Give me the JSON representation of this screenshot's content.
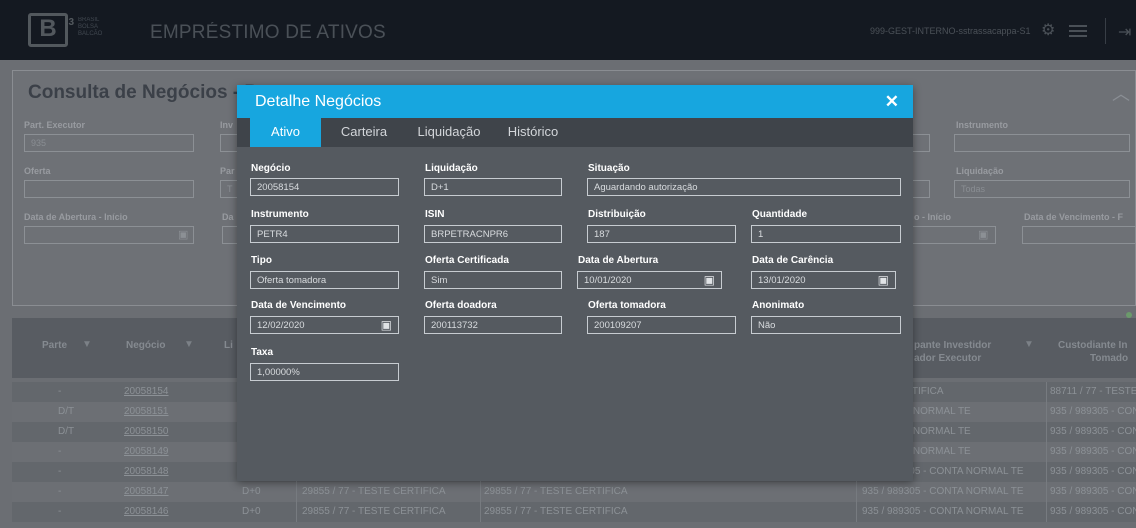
{
  "header": {
    "logo_text": "B",
    "logo_sup": "3",
    "logo_sub": [
      "BRASIL",
      "BOLSA",
      "BALCÃO"
    ],
    "app_title": "EMPRÉSTIMO DE ATIVOS",
    "user": "999-GEST-INTERNO-sstrassacappa-S1",
    "icons": [
      "gear-icon",
      "menu-icon",
      "logout-icon"
    ]
  },
  "background": {
    "title": "Consulta de Negócios - P",
    "filters": {
      "part_executor_label": "Part. Executor",
      "part_executor_value": "935",
      "inv_label": "Inv",
      "instrumento_label": "Instrumento",
      "oferta_label": "Oferta",
      "par_label": "Par",
      "liquidacao_label": "Liquidação",
      "liquidacao_value": "Todas",
      "abertura_label": "Data de Abertura - Início",
      "da_label": "Da",
      "o_inicio_label": "o - Início",
      "vencimento_label": "Data de Vencimento - F",
      "t_value": "T"
    },
    "table": {
      "headers": {
        "parte": "Parte",
        "negocio": "Negócio",
        "li": "Li",
        "part_inv_1": "pante Investidor",
        "part_inv_2": "ador Executor",
        "custodiante_1": "Custodiante In",
        "custodiante_2": "Tomado"
      },
      "rows": [
        {
          "parte": "-",
          "negocio": "20058154",
          "c1": "",
          "c2": "",
          "c3": "",
          "part": "ESTE CERTIFICA",
          "cust": "88711 / 77 - TESTE C"
        },
        {
          "parte": "D/T",
          "negocio": "20058151",
          "c1": "",
          "c2": "",
          "c3": "",
          "part": "5 - CONTA NORMAL TE",
          "cust": "935 / 989305 - CON"
        },
        {
          "parte": "D/T",
          "negocio": "20058150",
          "c1": "",
          "c2": "",
          "c3": "",
          "part": "5 - CONTA NORMAL TE",
          "cust": "935 / 989305 - CON"
        },
        {
          "parte": "-",
          "negocio": "20058149",
          "c1": "",
          "c2": "",
          "c3": "",
          "part": "5 - CONTA NORMAL TE",
          "cust": "935 / 989305 - CON"
        },
        {
          "parte": "-",
          "negocio": "20058148",
          "c1": "D+0",
          "c2": "29855 / 77 - TESTE CERTIFICA",
          "c3": "29855 / 77 - TESTE CERTIFICA",
          "part": "935 / 989305 - CONTA NORMAL TE",
          "cust": "935 / 989305 - CON"
        },
        {
          "parte": "-",
          "negocio": "20058147",
          "c1": "D+0",
          "c2": "29855 / 77 - TESTE CERTIFICA",
          "c3": "29855 / 77 - TESTE CERTIFICA",
          "part": "935 / 989305 - CONTA NORMAL TE",
          "cust": "935 / 989305 - CON"
        },
        {
          "parte": "-",
          "negocio": "20058146",
          "c1": "D+0",
          "c2": "29855 / 77 - TESTE CERTIFICA",
          "c3": "29855 / 77 - TESTE CERTIFICA",
          "part": "935 / 989305 - CONTA NORMAL TE",
          "cust": "935 / 989305 - CON"
        }
      ]
    }
  },
  "modal": {
    "title": "Detalhe Negócios",
    "close": "✕",
    "tabs": [
      "Ativo",
      "Carteira",
      "Liquidação",
      "Histórico"
    ],
    "fields": {
      "negocio": {
        "label": "Negócio",
        "value": "20058154"
      },
      "liquidacao": {
        "label": "Liquidação",
        "value": "D+1"
      },
      "situacao": {
        "label": "Situação",
        "value": "Aguardando autorização"
      },
      "instrumento": {
        "label": "Instrumento",
        "value": "PETR4"
      },
      "isin": {
        "label": "ISIN",
        "value": "BRPETRACNPR6"
      },
      "distribuicao": {
        "label": "Distribuição",
        "value": "187"
      },
      "quantidade": {
        "label": "Quantidade",
        "value": "1"
      },
      "tipo": {
        "label": "Tipo",
        "value": "Oferta tomadora"
      },
      "oferta_certificada": {
        "label": "Oferta Certificada",
        "value": "Sim"
      },
      "data_abertura": {
        "label": "Data de Abertura",
        "value": "10/01/2020"
      },
      "data_carencia": {
        "label": "Data de Carência",
        "value": "13/01/2020"
      },
      "data_vencimento": {
        "label": "Data de Vencimento",
        "value": "12/02/2020"
      },
      "oferta_doadora": {
        "label": "Oferta doadora",
        "value": "200113732"
      },
      "oferta_tomadora": {
        "label": "Oferta tomadora",
        "value": "200109207"
      },
      "anonimato": {
        "label": "Anonimato",
        "value": "Não"
      },
      "taxa": {
        "label": "Taxa",
        "value": "1,00000%"
      }
    }
  },
  "colors": {
    "accent": "#17a6df",
    "modal_bg": "#555a60",
    "overlay_bg": "#6b6e73"
  }
}
